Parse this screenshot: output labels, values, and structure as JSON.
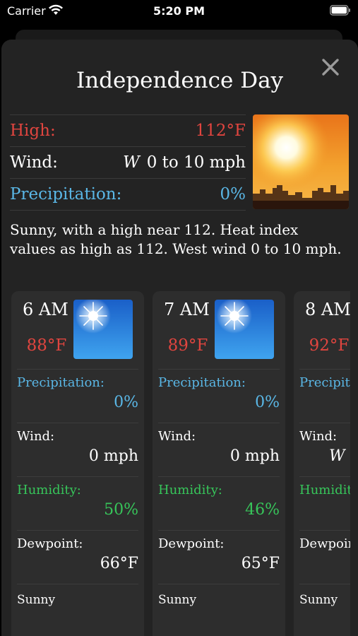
{
  "status_bar": {
    "carrier": "Carrier",
    "time": "5:20 PM"
  },
  "title": "Independence Day",
  "summary": {
    "high_label": "High:",
    "high_value": "112°F",
    "wind_label": "Wind:",
    "wind_dir": "W",
    "wind_value": "0 to 10 mph",
    "precip_label": "Precipitation:",
    "precip_value": "0%"
  },
  "description": "Sunny, with a high near 112. Heat index values as high as 112. West wind 0 to 10 mph.",
  "hourly": [
    {
      "hour": "6 AM",
      "temp": "88°F",
      "precip_label": "Precipitation:",
      "precip": "0%",
      "wind_label": "Wind:",
      "wind": "0 mph",
      "humidity_label": "Humidity:",
      "humidity": "50%",
      "dewpoint_label": "Dewpoint:",
      "dewpoint": "66°F",
      "condition": "Sunny"
    },
    {
      "hour": "7 AM",
      "temp": "89°F",
      "precip_label": "Precipitation:",
      "precip": "0%",
      "wind_label": "Wind:",
      "wind": "0 mph",
      "humidity_label": "Humidity:",
      "humidity": "46%",
      "dewpoint_label": "Dewpoint:",
      "dewpoint": "65°F",
      "condition": "Sunny"
    },
    {
      "hour": "8 AM",
      "temp": "92°F",
      "precip_label": "Precipitation:",
      "precip": "",
      "wind_label": "Wind:",
      "wind": "W",
      "humidity_label": "Humidity:",
      "humidity": "",
      "dewpoint_label": "Dewpoint:",
      "dewpoint": "",
      "condition": "Sunny"
    }
  ],
  "colors": {
    "high": "#e0453f",
    "precipitation": "#5ab7e6",
    "humidity": "#37c55a"
  }
}
